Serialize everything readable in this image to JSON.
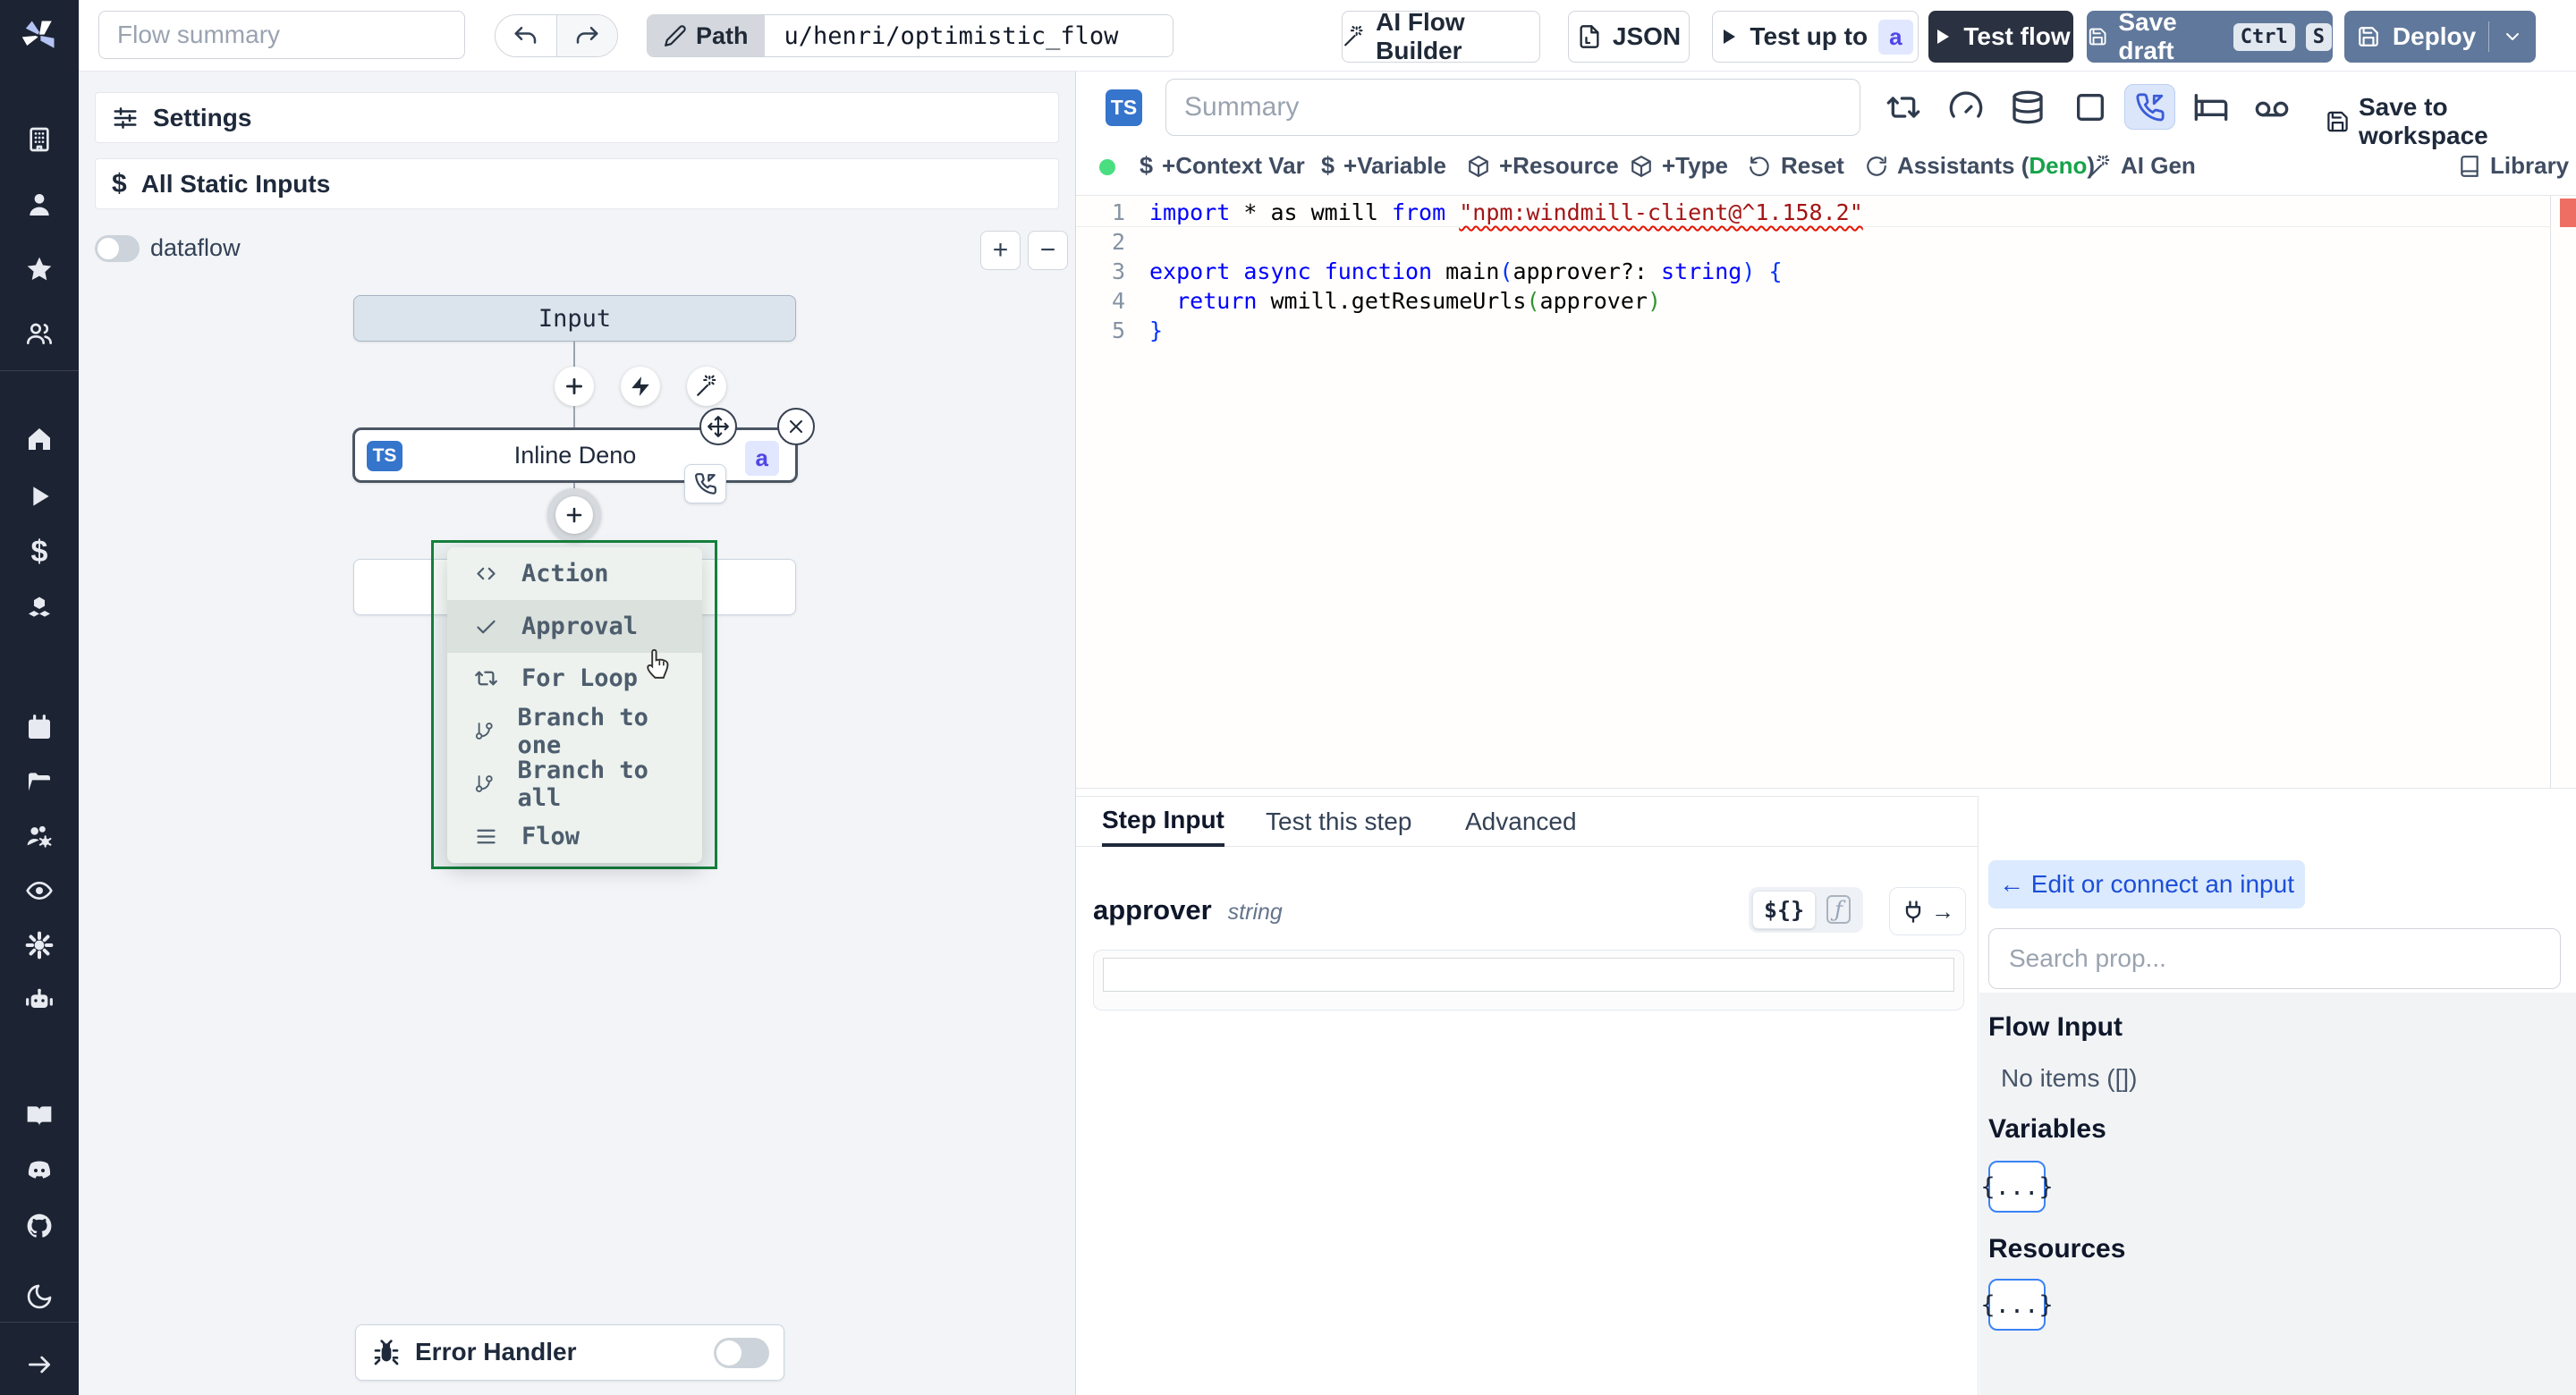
{
  "topbar": {
    "flow_summary_placeholder": "Flow summary",
    "path_label": "Path",
    "path_value": "u/henri/optimistic_flow",
    "ai_flow_builder": "AI Flow Builder",
    "json_label": "JSON",
    "test_up_to": "Test up to",
    "test_up_to_badge": "a",
    "test_flow": "Test flow",
    "save_draft": "Save draft",
    "save_draft_keys": [
      "Ctrl",
      "S"
    ],
    "deploy": "Deploy"
  },
  "flow_panel": {
    "settings": "Settings",
    "all_static_inputs": "All Static Inputs",
    "dataflow_label": "dataflow",
    "zoom_in": "+",
    "zoom_out": "−",
    "input_node_label": "Input",
    "step_node": {
      "lang_badge": "TS",
      "label": "Inline Deno",
      "id_badge": "a"
    },
    "insert_menu": {
      "items": [
        {
          "icon": "code-icon",
          "label": "Action"
        },
        {
          "icon": "check-icon",
          "label": "Approval",
          "highlighted": true
        },
        {
          "icon": "repeat-icon",
          "label": "For Loop"
        },
        {
          "icon": "git-branch-icon",
          "label": "Branch to one"
        },
        {
          "icon": "git-branch-icon",
          "label": "Branch to all"
        },
        {
          "icon": "menu-icon",
          "label": "Flow"
        }
      ]
    },
    "error_handler": "Error Handler"
  },
  "editor_panel": {
    "lang_badge": "TS",
    "summary_placeholder": "Summary",
    "save_to_workspace": "Save to workspace",
    "status_color": "#4ade80",
    "actions": {
      "context_var": "+Context Var",
      "variable": "+Variable",
      "resource": "+Resource",
      "type": "+Type",
      "reset": "Reset",
      "assistants_prefix": "Assistants (",
      "assistants_lang": "Deno",
      "assistants_suffix": ")",
      "assistants_lang_color": "#16a34a",
      "ai_gen": "AI Gen",
      "library": "Library"
    },
    "code": {
      "line_numbers": [
        "1",
        "2",
        "3",
        "4",
        "5"
      ],
      "lines": [
        [
          {
            "t": "import",
            "c": "kw"
          },
          {
            "t": " * as wmill ",
            "c": "pl"
          },
          {
            "t": "from",
            "c": "kw"
          },
          {
            "t": " ",
            "c": "pl"
          },
          {
            "t": "\"npm:windmill-client@^1.158.2\"",
            "c": "str sq"
          }
        ],
        [],
        [
          {
            "t": "export",
            "c": "kw"
          },
          {
            "t": " ",
            "c": "pl"
          },
          {
            "t": "async",
            "c": "kw"
          },
          {
            "t": " ",
            "c": "pl"
          },
          {
            "t": "function",
            "c": "kw"
          },
          {
            "t": " main",
            "c": "pl"
          },
          {
            "t": "(",
            "c": "p1"
          },
          {
            "t": "approver?: ",
            "c": "pl"
          },
          {
            "t": "string",
            "c": "kw"
          },
          {
            "t": ")",
            "c": "p1"
          },
          {
            "t": " ",
            "c": "pl"
          },
          {
            "t": "{",
            "c": "p1"
          }
        ],
        [
          {
            "t": "  ",
            "c": "pl"
          },
          {
            "t": "return",
            "c": "kw"
          },
          {
            "t": " wmill.getResumeUrls",
            "c": "pl"
          },
          {
            "t": "(",
            "c": "p2"
          },
          {
            "t": "approver",
            "c": "pl"
          },
          {
            "t": ")",
            "c": "p2"
          }
        ],
        [
          {
            "t": "}",
            "c": "p1"
          }
        ]
      ]
    }
  },
  "step_panel": {
    "tabs": [
      "Step Input",
      "Test this step",
      "Advanced"
    ],
    "active_tab": "Step Input",
    "field_name": "approver",
    "field_type": "string",
    "expr_toggle": "${}",
    "fn_toggle": "ƒ",
    "plug_arrow": "→"
  },
  "connect_panel": {
    "edit_button": "← Edit or connect an input",
    "search_placeholder": "Search prop...",
    "flow_input_title": "Flow Input",
    "flow_input_empty": "No items ([])",
    "variables_title": "Variables",
    "variables_chip": "{...}",
    "resources_title": "Resources",
    "resources_chip": "{...}"
  }
}
